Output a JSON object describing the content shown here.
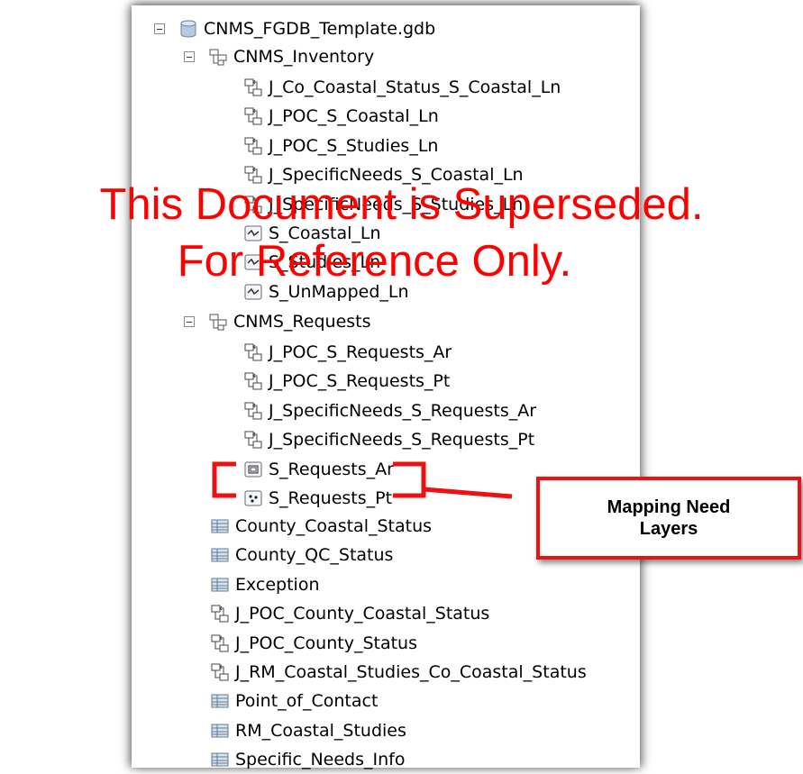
{
  "tree": {
    "root": {
      "label": "CNMS_FGDB_Template.gdb",
      "icon": "geodatabase-icon"
    },
    "inventory": {
      "label": "CNMS_Inventory",
      "icon": "feature-dataset-icon",
      "items": [
        {
          "label": "J_Co_Coastal_Status_S_Coastal_Ln",
          "icon": "relationship-class-icon"
        },
        {
          "label": "J_POC_S_Coastal_Ln",
          "icon": "relationship-class-icon"
        },
        {
          "label": "J_POC_S_Studies_Ln",
          "icon": "relationship-class-icon"
        },
        {
          "label": "J_SpecificNeeds_S_Coastal_Ln",
          "icon": "relationship-class-icon"
        },
        {
          "label": "J_SpecificNeeds_S_Studies_Ln",
          "icon": "relationship-class-icon"
        },
        {
          "label": "S_Coastal_Ln",
          "icon": "line-feature-class-icon"
        },
        {
          "label": "S_Studies_Ln",
          "icon": "line-feature-class-icon"
        },
        {
          "label": "S_UnMapped_Ln",
          "icon": "line-feature-class-icon"
        }
      ]
    },
    "requests": {
      "label": "CNMS_Requests",
      "icon": "feature-dataset-icon",
      "items": [
        {
          "label": "J_POC_S_Requests_Ar",
          "icon": "relationship-class-icon"
        },
        {
          "label": "J_POC_S_Requests_Pt",
          "icon": "relationship-class-icon"
        },
        {
          "label": "J_SpecificNeeds_S_Requests_Ar",
          "icon": "relationship-class-icon"
        },
        {
          "label": "J_SpecificNeeds_S_Requests_Pt",
          "icon": "relationship-class-icon"
        },
        {
          "label": "S_Requests_Ar",
          "icon": "polygon-feature-class-icon"
        },
        {
          "label": "S_Requests_Pt",
          "icon": "point-feature-class-icon"
        }
      ]
    },
    "tables": [
      {
        "label": "County_Coastal_Status",
        "icon": "table-icon"
      },
      {
        "label": "County_QC_Status",
        "icon": "table-icon"
      },
      {
        "label": "Exception",
        "icon": "table-icon"
      },
      {
        "label": "J_POC_County_Coastal_Status",
        "icon": "relationship-class-icon"
      },
      {
        "label": "J_POC_County_Status",
        "icon": "relationship-class-icon"
      },
      {
        "label": "J_RM_Coastal_Studies_Co_Coastal_Status",
        "icon": "relationship-class-icon"
      },
      {
        "label": "Point_of_Contact",
        "icon": "table-icon"
      },
      {
        "label": "RM_Coastal_Studies",
        "icon": "table-icon"
      },
      {
        "label": "Specific_Needs_Info",
        "icon": "table-icon"
      }
    ]
  },
  "watermark": {
    "line1": "This Document is Superseded.",
    "line2": "For Reference Only."
  },
  "callout": {
    "line1": "Mapping Need",
    "line2": "Layers"
  },
  "colors": {
    "annotation": "#ee1111",
    "watermark": "#ff0000"
  }
}
